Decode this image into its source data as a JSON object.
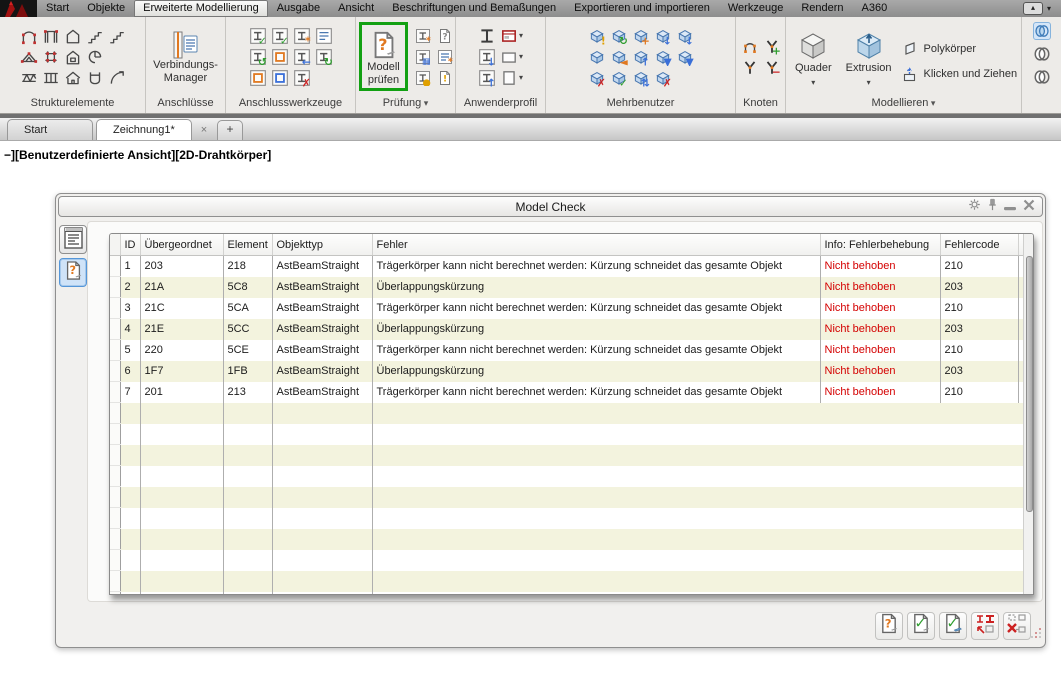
{
  "ui": {
    "close_symbol": "×",
    "add_tab_symbol": "+",
    "caret_symbol": "▾"
  },
  "icons": {
    "app-logo-icon": "red-advance-steel-mark",
    "ribbon_toggle_box": "▴",
    "ribbon_toggle_caret": "▾",
    "gear-icon": "gear",
    "pin-icon": "pushpin",
    "minimize-icon": "dash",
    "close-icon": "x-cross",
    "report-list-icon": "lined-notepad",
    "model-check-icon": "document-question-beam",
    "check-model-button-icon": "document-question-beam",
    "recheck-model-button-icon": "document-green-check",
    "check-database-button-icon": "document-green-check-blue-beam",
    "show-object-button-icon": "red-beams-zoom-arrow",
    "clear-marks-button-icon": "boxes-red-x"
  },
  "ribbon": {
    "tabs": [
      {
        "label": "Start",
        "active": false
      },
      {
        "label": "Objekte",
        "active": false
      },
      {
        "label": "Erweiterte Modellierung",
        "active": true
      },
      {
        "label": "Ausgabe",
        "active": false
      },
      {
        "label": "Ansicht",
        "active": false
      },
      {
        "label": "Beschriftungen und Bemaßungen",
        "active": false
      },
      {
        "label": "Exportieren und importieren",
        "active": false
      },
      {
        "label": "Werkzeuge",
        "active": false
      },
      {
        "label": "Rendern",
        "active": false
      },
      {
        "label": "A360",
        "active": false
      }
    ],
    "group_labels": [
      "Strukturelemente",
      "Anschlüsse",
      "Anschlusswerkzeuge",
      "Prüfung",
      "Anwenderprofil",
      "Mehrbenutzer",
      "Knoten",
      "Modellieren"
    ],
    "buttons": {
      "verbindungs_manager_line1": "Verbindungs-",
      "verbindungs_manager_line2": "Manager",
      "modell_pruefen_line1": "Modell",
      "modell_pruefen_line2": "prüfen",
      "quader": "Quader",
      "extrusion": "Extrusion",
      "polykoerper": "Polykörper",
      "klicken_und_ziehen": "Klicken und Ziehen"
    },
    "icon_sets": {
      "strukturelemente": [
        [
          "portal-arch|arch",
          "portal-frame|frame",
          "gable-wall|gable",
          "stair-straight|stair",
          "stair-flight|stair"
        ],
        [
          "truss|truss",
          "grid-axes|axes",
          "gable-wall-opening|gableo",
          "spiral-stair|spiral"
        ],
        [
          "lattice-girder|lattice",
          "plate-girder|girder",
          "building|house",
          "handrail|rail",
          "curved-stair|curve"
        ]
      ],
      "anschlusswerkzeuge": [
        [
          "verify-connection|pic|✓|#2e9e2e",
          "verify-all-connections|pic|✓|#2e9e2e",
          "create-connection-group|pic|*|#e07820",
          "connection-properties|piclines||"
        ],
        [
          "restore-connection|pic|↺|#2e9e2e",
          "connection-section-box|picbox||#e07820",
          "insert-connection-object|pic|←|#3a6fd8",
          "reload-connection|pic|↻|#2e9e2e"
        ],
        [
          "connection-solid|picbox||#e07820",
          "connection-frame|picbox||#3a6fd8",
          "delete-connection|pic|✗|#cc2222"
        ]
      ],
      "pruefung_small": [
        [
          "clash-check|pic|*|#e07820",
          "help-document|doc|?|#8a8a8a"
        ],
        [
          "display-errors|pic|▦|#3a6fd8",
          "check-list|piclines|*|#e07820"
        ],
        [
          "audit-model|pic|●|#e0a000",
          "audit-messages|doc|!|#e0a000"
        ]
      ],
      "anwenderprofil": [
        [
          "beam-section|ibeam||",
          "display-configuration|window||#aa2222|caret"
        ],
        [
          "beam-database-export|pic|↓|#3a6fd8",
          "viewport-frame|rect||#777777|caret"
        ],
        [
          "beam-database-import|pic|↑|#3a6fd8",
          "sheet-new|sheet||#777777|caret"
        ]
      ],
      "mehrbenutzer": [
        [
          "reserve-element|cube|!|#e0a000",
          "sync-element|cube|↻|#2e9e2e",
          "add-element|cube|+|#e07820",
          "download-elements|cube|↓|#3a6fd8",
          "download-all-elements|cube|↓|#3a6fd8"
        ],
        [
          "release-element|cube||",
          "take-over-element|cube|◄|#e07820",
          "upload-element|cube|↑|#3a6fd8",
          "merge-elements|cube|▼|#3a6fd8",
          "compare-elements|cube|▼|#3a6fd8"
        ],
        [
          "reject-element|cube|✗|#cc2222",
          "approve-element|cube|✓|#2e9e2e",
          "sync-all-elements|cube|⇅|#3a6fd8",
          "delete-element|cube|✗|#cc2222"
        ]
      ],
      "knoten": [
        [
          "node-arc|node||",
          "node-add|y|+|#2e9e2e"
        ],
        [
          "node-y|y||",
          "node-remove|y|−|#cc2222"
        ]
      ],
      "modellieren_small": [
        [
          "polysolid|poly||"
        ],
        [
          "press-pull|pull||"
        ]
      ],
      "visual_styles": [
        [
          "visual-style-1|venn-active||"
        ],
        [
          "visual-style-2|venn||"
        ],
        [
          "visual-style-3|venn||"
        ]
      ]
    }
  },
  "file_tabs": {
    "tabs": [
      {
        "label": "Start",
        "active": false
      },
      {
        "label": "Zeichnung1*",
        "active": true
      }
    ]
  },
  "viewport_label": "−][Benutzerdefinierte Ansicht][2D-Drahtkörper]",
  "dialog": {
    "title": "Model Check",
    "table": {
      "columns": [
        "ID",
        "Übergeordnet",
        "Element",
        "Objekttyp",
        "Fehler",
        "Info: Fehlerbehebung",
        "Fehlercode"
      ],
      "rows": [
        [
          "1",
          "203",
          "218",
          "AstBeamStraight",
          "Trägerkörper kann nicht berechnet werden: Kürzung schneidet das gesamte Objekt",
          "Nicht behoben",
          "210"
        ],
        [
          "2",
          "21A",
          "5C8",
          "AstBeamStraight",
          "Überlappungskürzung",
          "Nicht behoben",
          "203"
        ],
        [
          "3",
          "21C",
          "5CA",
          "AstBeamStraight",
          "Trägerkörper kann nicht berechnet werden: Kürzung schneidet das gesamte Objekt",
          "Nicht behoben",
          "210"
        ],
        [
          "4",
          "21E",
          "5CC",
          "AstBeamStraight",
          "Überlappungskürzung",
          "Nicht behoben",
          "203"
        ],
        [
          "5",
          "220",
          "5CE",
          "AstBeamStraight",
          "Trägerkörper kann nicht berechnet werden: Kürzung schneidet das gesamte Objekt",
          "Nicht behoben",
          "210"
        ],
        [
          "6",
          "1F7",
          "1FB",
          "AstBeamStraight",
          "Überlappungskürzung",
          "Nicht behoben",
          "203"
        ],
        [
          "7",
          "201",
          "213",
          "AstBeamStraight",
          "Trägerkörper kann nicht berechnet werden: Kürzung schneidet das gesamte Objekt",
          "Nicht behoben",
          "210"
        ]
      ],
      "empty_rows": 11
    }
  },
  "colors": {
    "highlight_green": "#12a012",
    "error_red": "#d40000",
    "stripe_cream": "#f3f3de",
    "selected_blue": "#5596d8"
  }
}
